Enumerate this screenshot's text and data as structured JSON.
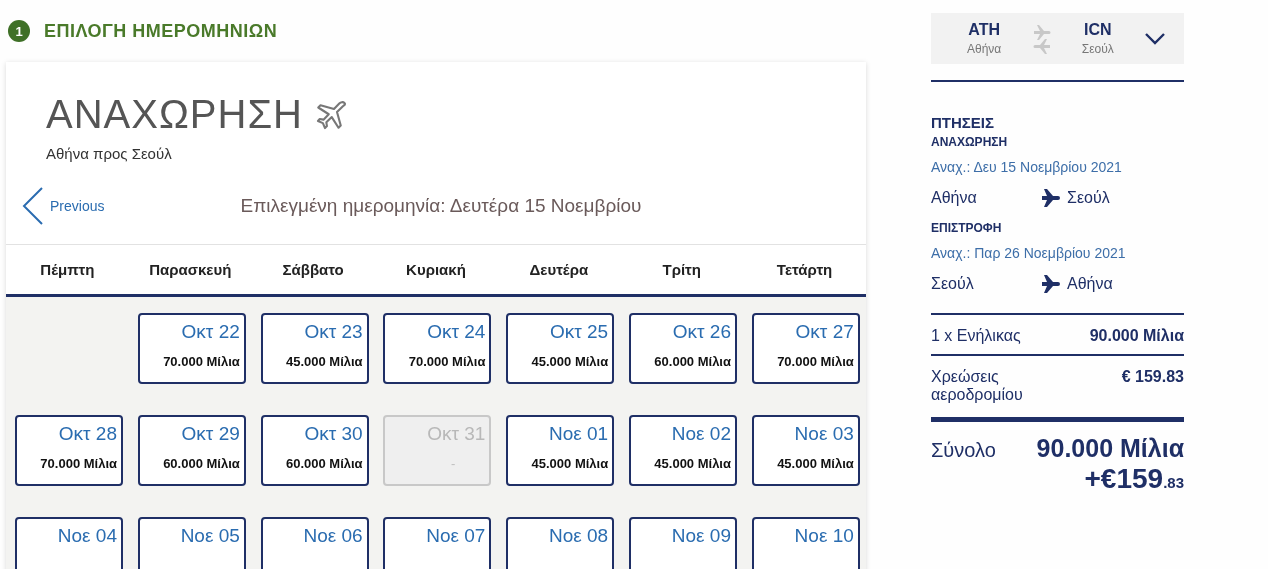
{
  "step": {
    "number": "1",
    "title": "ΕΠΙΛΟΓΗ ΗΜΕΡΟΜΗΝΙΩΝ"
  },
  "calendar": {
    "title": "ΑΝΑΧΩΡΗΣΗ",
    "subtitle": "Αθήνα προς Σεούλ",
    "previous": "Previous",
    "selected_date": "Επιλεγμένη ημερομηνία: Δευτέρα 15 Νοεμβρίου",
    "weekdays": [
      "Πέμπτη",
      "Παρασκευή",
      "Σάββατο",
      "Κυριακή",
      "Δευτέρα",
      "Τρίτη",
      "Τετάρτη"
    ],
    "weeks": [
      [
        {
          "kind": "blank"
        },
        {
          "kind": "day",
          "date": "Οκτ 22",
          "price": "70.000 Μίλια",
          "disabled": false
        },
        {
          "kind": "day",
          "date": "Οκτ 23",
          "price": "45.000 Μίλια",
          "disabled": false
        },
        {
          "kind": "day",
          "date": "Οκτ 24",
          "price": "70.000 Μίλια",
          "disabled": false
        },
        {
          "kind": "day",
          "date": "Οκτ 25",
          "price": "45.000 Μίλια",
          "disabled": false
        },
        {
          "kind": "day",
          "date": "Οκτ 26",
          "price": "60.000 Μίλια",
          "disabled": false
        },
        {
          "kind": "day",
          "date": "Οκτ 27",
          "price": "70.000 Μίλια",
          "disabled": false
        }
      ],
      [
        {
          "kind": "day",
          "date": "Οκτ 28",
          "price": "70.000 Μίλια",
          "disabled": false
        },
        {
          "kind": "day",
          "date": "Οκτ 29",
          "price": "60.000 Μίλια",
          "disabled": false
        },
        {
          "kind": "day",
          "date": "Οκτ 30",
          "price": "60.000 Μίλια",
          "disabled": false
        },
        {
          "kind": "day",
          "date": "Οκτ 31",
          "price": "-",
          "disabled": true
        },
        {
          "kind": "day",
          "date": "Νοε 01",
          "price": "45.000 Μίλια",
          "disabled": false
        },
        {
          "kind": "day",
          "date": "Νοε 02",
          "price": "45.000 Μίλια",
          "disabled": false
        },
        {
          "kind": "day",
          "date": "Νοε 03",
          "price": "45.000 Μίλια",
          "disabled": false
        }
      ],
      [
        {
          "kind": "day",
          "date": "Νοε 04",
          "disabled": false
        },
        {
          "kind": "day",
          "date": "Νοε 05",
          "disabled": false
        },
        {
          "kind": "day",
          "date": "Νοε 06",
          "disabled": false
        },
        {
          "kind": "day",
          "date": "Νοε 07",
          "disabled": false
        },
        {
          "kind": "day",
          "date": "Νοε 08",
          "disabled": false
        },
        {
          "kind": "day",
          "date": "Νοε 09",
          "disabled": false
        },
        {
          "kind": "day",
          "date": "Νοε 10",
          "disabled": false
        }
      ]
    ]
  },
  "route": {
    "origin_code": "ATH",
    "origin_city": "Αθήνα",
    "dest_code": "ICN",
    "dest_city": "Σεούλ"
  },
  "summary": {
    "heading": "ΠΤΗΣΕΙΣ",
    "flights": [
      {
        "label": "ΑΝΑΧΩΡΗΣΗ",
        "date": "Αναχ.: Δευ 15 Νοεμβρίου 2021",
        "from": "Αθήνα",
        "to": "Σεούλ"
      },
      {
        "label": "ΕΠΙΣΤΡΟΦΗ",
        "date": "Αναχ.: Παρ 26 Νοεμβρίου 2021",
        "from": "Σεούλ",
        "to": "Αθήνα"
      }
    ],
    "lines": [
      {
        "label": "1 x Ενήλικας",
        "value": "90.000 Μίλια"
      },
      {
        "label": "Χρεώσεις αεροδρομίου",
        "value": "€ 159.83"
      }
    ],
    "total_label": "Σύνολο",
    "total_miles": "90.000 Μίλια",
    "total_plus": "+€",
    "total_euros": "159",
    ".cents": ".83"
  }
}
